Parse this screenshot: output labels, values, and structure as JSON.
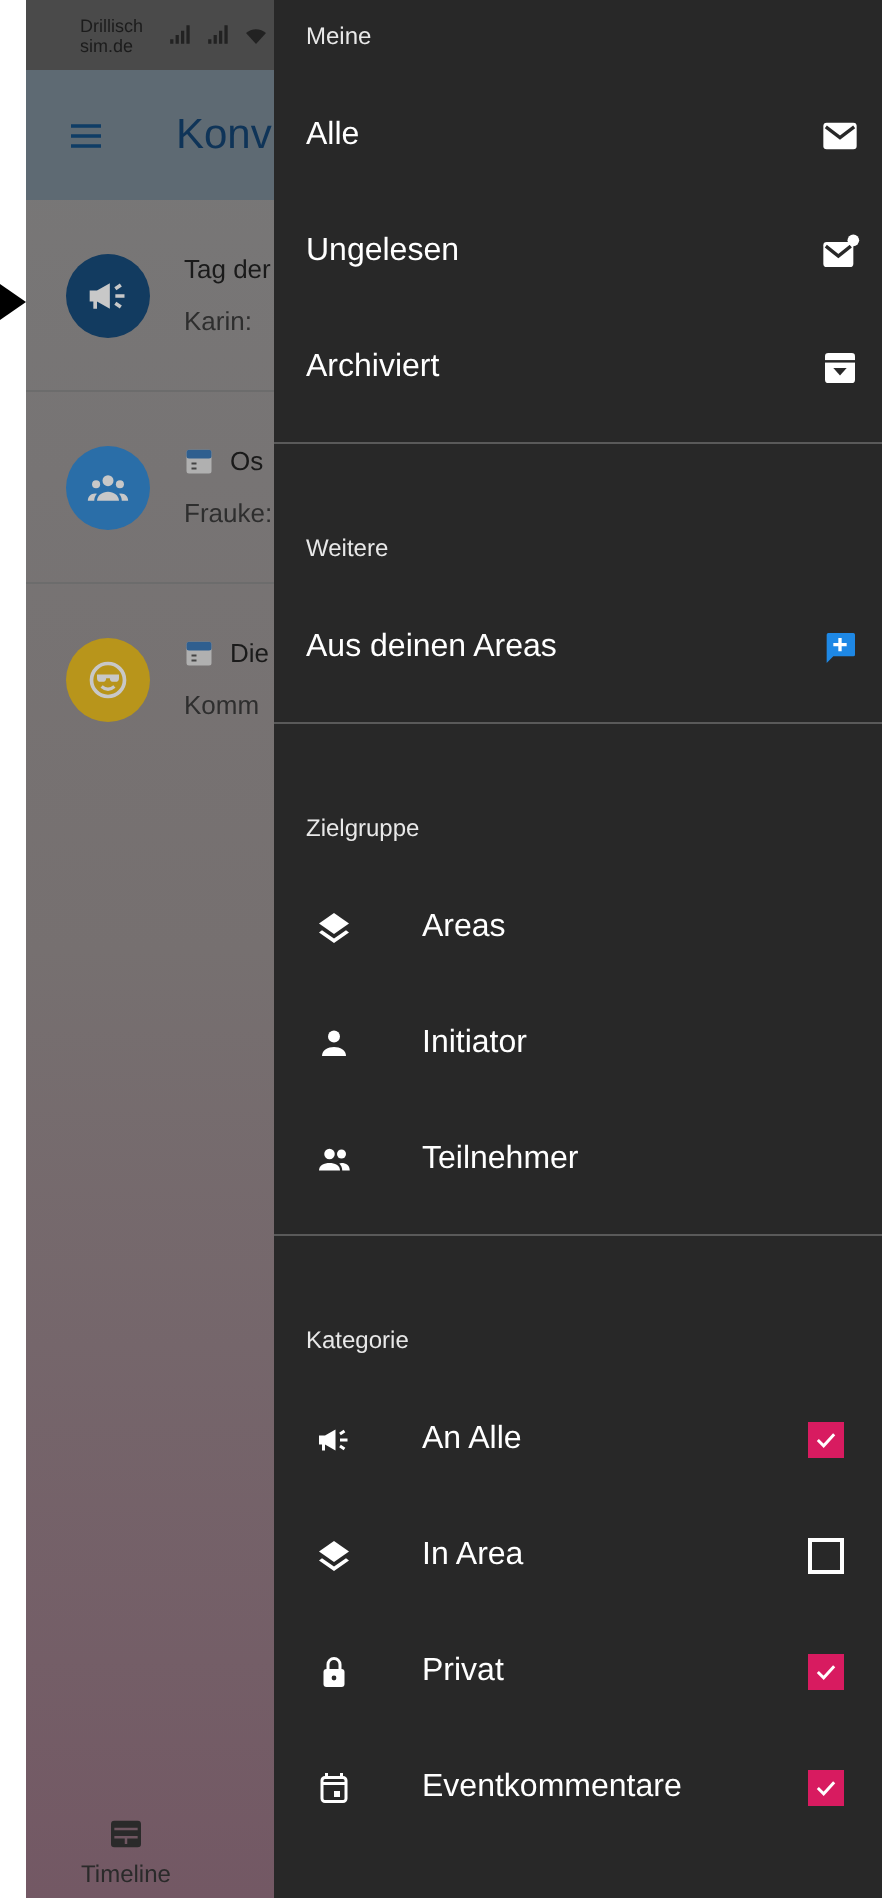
{
  "status_bar": {
    "carrier": [
      "Drillisch",
      "sim.de"
    ]
  },
  "app_bar": {
    "title": "Konv"
  },
  "conversations": [
    {
      "event": false,
      "title": "Tag der",
      "preview": "Karin:",
      "color": "#123b60"
    },
    {
      "event": true,
      "title": "Os",
      "preview": "Frauke:",
      "color": "#2a6ea8"
    },
    {
      "event": true,
      "title": "Die",
      "preview": "Komm",
      "color": "#b8951b"
    }
  ],
  "bottom_nav": [
    {
      "label": "Timeline"
    }
  ],
  "drawer": {
    "sections": [
      {
        "title": "Meine",
        "items": [
          {
            "kind": "link",
            "label": "Alle"
          },
          {
            "kind": "link",
            "label": "Ungelesen"
          },
          {
            "kind": "link",
            "label": "Archiviert"
          }
        ]
      },
      {
        "title": "Weitere",
        "items": [
          {
            "kind": "link",
            "label": "Aus deinen Areas"
          }
        ]
      },
      {
        "title": "Zielgruppe",
        "items": [
          {
            "kind": "filter",
            "label": "Areas"
          },
          {
            "kind": "filter",
            "label": "Initiator"
          },
          {
            "kind": "filter",
            "label": "Teilnehmer"
          }
        ]
      },
      {
        "title": "Kategorie",
        "items": [
          {
            "kind": "check",
            "label": "An Alle",
            "checked": true
          },
          {
            "kind": "check",
            "label": "In Area",
            "checked": false
          },
          {
            "kind": "check",
            "label": "Privat",
            "checked": true
          },
          {
            "kind": "check",
            "label": "Eventkommentare",
            "checked": true
          }
        ]
      }
    ]
  }
}
